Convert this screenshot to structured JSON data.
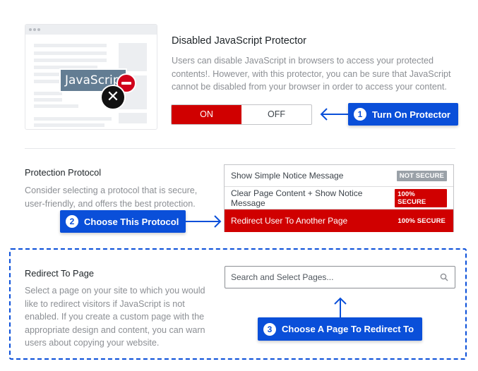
{
  "illustration": {
    "badge_text": "JavaScript",
    "icons": [
      "no-entry-icon",
      "close-circle-icon"
    ]
  },
  "protector": {
    "title": "Disabled JavaScript Protector",
    "description": "Users can disable JavaScript in browsers to access your protected contents!. However, with this protector, you can be sure that JavaScript cannot be disabled from your browser in order to access your content.",
    "toggle": {
      "on_label": "ON",
      "off_label": "OFF",
      "selected": "ON"
    }
  },
  "callouts": [
    {
      "number": "1",
      "label": "Turn On Protector",
      "color": "#0a4fd9"
    },
    {
      "number": "2",
      "label": "Choose This Protocol",
      "color": "#0a4fd9"
    },
    {
      "number": "3",
      "label": "Choose A Page To Redirect To",
      "color": "#0a4fd9"
    }
  ],
  "protocol": {
    "title": "Protection Protocol",
    "description": "Consider selecting a protocol that is secure, user-friendly, and offers the best protection.",
    "options": [
      {
        "label": "Show Simple Notice Message",
        "badge": "NOT SECURE",
        "selected": false
      },
      {
        "label": "Clear Page Content + Show Notice Message",
        "badge": "100% SECURE",
        "selected": false
      },
      {
        "label": "Redirect User To Another Page",
        "badge": "100% SECURE",
        "selected": true
      }
    ]
  },
  "redirect": {
    "title": "Redirect To Page",
    "description": "Select a page on your site to which you would like to redirect visitors if JavaScript is not enabled. If you create a custom page with the appropriate design and content, you can warn users about copying your website.",
    "search_placeholder": "Search and Select Pages...",
    "search_icon": "search-icon"
  },
  "colors": {
    "accent_red": "#d00000",
    "callout_blue": "#0a4fd9",
    "badge_grey": "#9aa1a8"
  }
}
